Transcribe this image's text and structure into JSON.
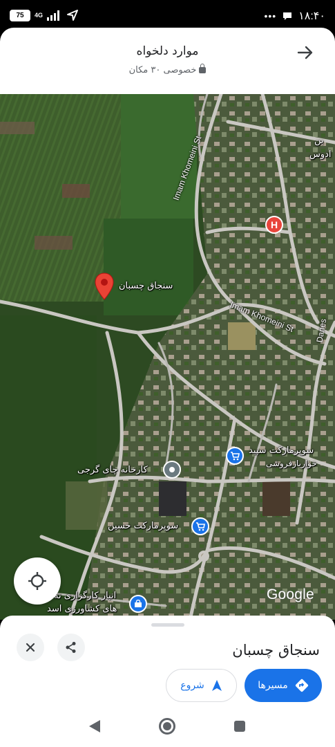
{
  "status_bar": {
    "battery": "75",
    "network": "4G",
    "time": "۱۸:۴۰"
  },
  "header": {
    "title": "موارد دلخواه",
    "subtitle": "خصوصی ۳۰ مکان"
  },
  "map": {
    "pin_label": "سنجاق چسبان",
    "street_1": "Imam Khomeini St",
    "street_2": "Imam Khomeini St",
    "street_3": "Danes",
    "top_right_label_1": "بن",
    "top_right_label_2": "ادوس",
    "poi_factory": "کارخانه چای گرجی",
    "poi_market_1_line1": "سوپرمارکت سپید",
    "poi_market_1_line2": "خواربارفروشی",
    "poi_market_2": "سوپرمارکت حسین",
    "poi_warehouse_line1": "انبار کارگزاری نه",
    "poi_warehouse_line2": "های کشاورزی اسد",
    "hospital_letter": "H",
    "attribution": "Google",
    "colors": {
      "pin": "#ea4335",
      "hospital": "#e8453c",
      "shop": "#1a73e8",
      "factory": "#6b7a80"
    }
  },
  "sheet": {
    "title": "سنجاق چسبان",
    "directions_label": "مسیرها",
    "start_label": "شروع",
    "accent": "#1a73e8"
  }
}
